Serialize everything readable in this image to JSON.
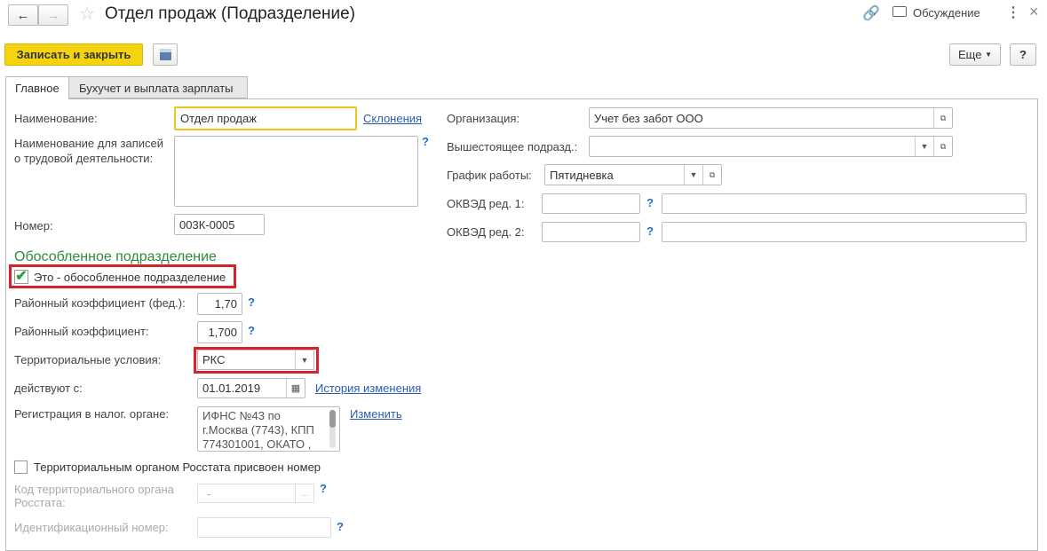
{
  "header": {
    "title": "Отдел продаж (Подразделение)",
    "discussion": "Обсуждение"
  },
  "toolbar": {
    "save_close": "Записать и закрыть",
    "more": "Еще",
    "help": "?"
  },
  "tabs": [
    {
      "label": "Главное",
      "active": true
    },
    {
      "label": "Бухучет и выплата зарплаты",
      "active": false
    }
  ],
  "left": {
    "name_label": "Наименование:",
    "name_value": "Отдел продаж",
    "declensions": "Склонения",
    "labor_label_1": "Наименование для записей",
    "labor_label_2": "о трудовой деятельности:",
    "labor_value": "",
    "number_label": "Номер:",
    "number_value": "003К-0005",
    "section": "Обособленное подразделение",
    "separate_label": "Это - обособленное подразделение",
    "separate_checked": true,
    "coef_fed_label": "Районный коэффициент (фед.):",
    "coef_fed_value": "1,70",
    "coef_label": "Районный коэффициент:",
    "coef_value": "1,700",
    "terr_label": "Территориальные условия:",
    "terr_value": "РКС",
    "since_label": "действуют с:",
    "since_value": "01.01.2019",
    "history": "История изменения",
    "tax_label": "Регистрация в налог. органе:",
    "tax_value": "ИФНС №43 по г.Москва (7743), КПП 774301001, ОКАТО ,",
    "change": "Изменить",
    "rosstat_label": "Территориальным органом Росстата присвоен номер",
    "rosstat_checked": false,
    "rosstat_code_label_1": "Код территориального органа",
    "rosstat_code_label_2": "Росстата:",
    "rosstat_code_value": "-",
    "id_label": "Идентификационный номер:",
    "id_value": ""
  },
  "right": {
    "org_label": "Организация:",
    "org_value": "Учет без забот ООО",
    "parent_label": "Вышестоящее подразд.:",
    "parent_value": "",
    "schedule_label": "График работы:",
    "schedule_value": "Пятидневка",
    "okved1_label": "ОКВЭД ред. 1:",
    "okved2_label": "ОКВЭД ред. 2:"
  },
  "q": "?",
  "colors": {
    "accent": "#f5d40f",
    "section": "#2e8b3c",
    "highlight": "#d6222a",
    "link": "#2a5db0"
  }
}
